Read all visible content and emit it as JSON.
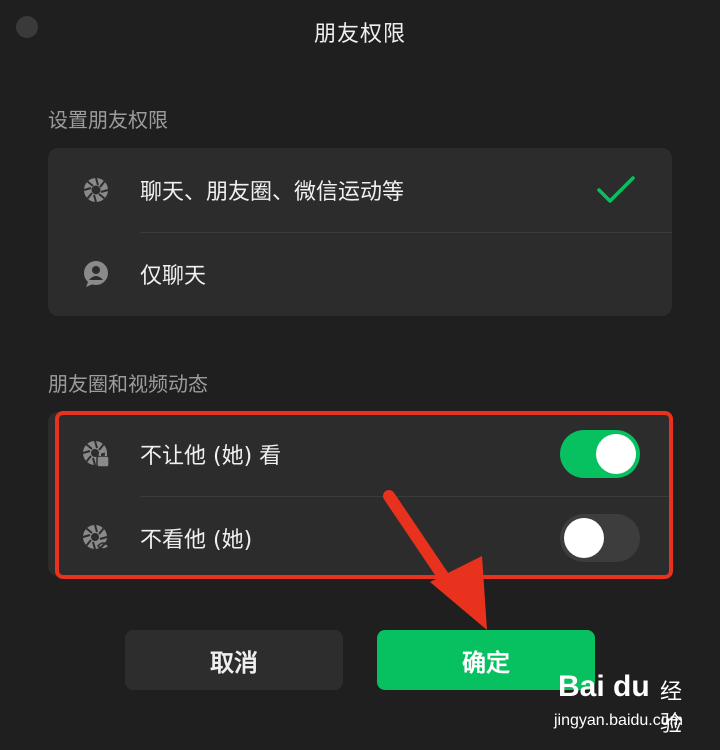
{
  "window": {
    "title": "朋友权限"
  },
  "permissions": {
    "section_label": "设置朋友权限",
    "items": [
      {
        "label": "聊天、朋友圈、微信运动等",
        "icon": "aperture-icon",
        "selected": true
      },
      {
        "label": "仅聊天",
        "icon": "chat-bubble-icon",
        "selected": false
      }
    ]
  },
  "moments": {
    "section_label": "朋友圈和视频动态",
    "items": [
      {
        "label": "不让他 (她) 看",
        "icon": "aperture-lock-icon",
        "toggle_on": true
      },
      {
        "label": "不看他 (她)",
        "icon": "aperture-hidden-icon",
        "toggle_on": false
      }
    ]
  },
  "buttons": {
    "cancel": "取消",
    "confirm": "确定"
  },
  "colors": {
    "accent": "#07c160",
    "annotation": "#e8321e"
  },
  "watermark": {
    "brand": "Bai du",
    "suffix": "经验",
    "url": "jingyan.baidu.com"
  }
}
